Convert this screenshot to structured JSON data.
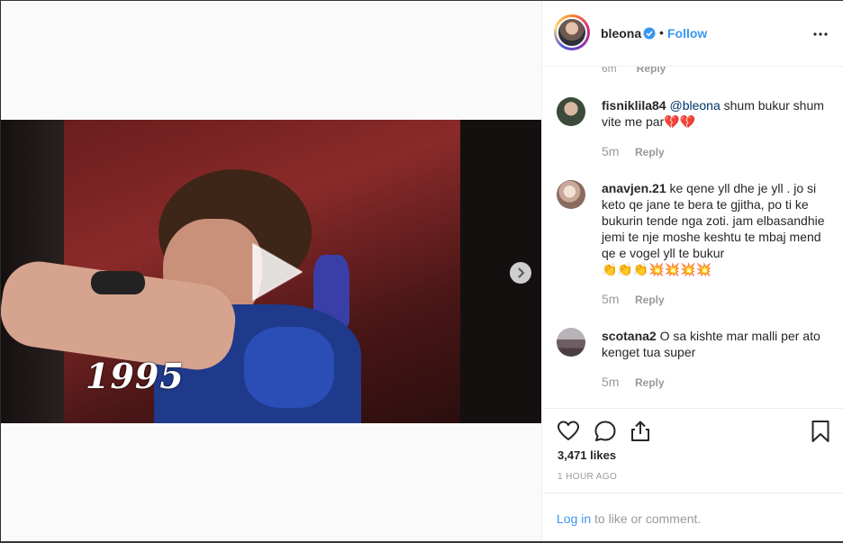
{
  "post": {
    "username": "bleona",
    "separator": "•",
    "follow_label": "Follow",
    "year_overlay": "1995"
  },
  "comments": {
    "partial_time": "6m",
    "partial_reply": "Reply",
    "items": [
      {
        "username": "fisniklila84",
        "mention": "@bleona",
        "text": " shum bukur shum vite me par",
        "emoji": "💔💔",
        "time": "5m",
        "reply": "Reply"
      },
      {
        "username": "anavjen.21",
        "mention": "",
        "text": " ke qene yll dhe je yll . jo si keto qe jane te bera te gjitha, po ti ke bukurin tende nga zoti. jam elbasandhie jemi te nje moshe keshtu te mbaj mend qe e vogel yll te bukur",
        "emoji": "👏👏👏💥💥💥💥",
        "time": "5m",
        "reply": "Reply"
      },
      {
        "username": "scotana2",
        "mention": "",
        "text": " O sa kishte mar malli per ato kenget tua super",
        "emoji": "",
        "time": "5m",
        "reply": "Reply"
      }
    ]
  },
  "stats": {
    "likes": "3,471 likes",
    "timestamp": "1 HOUR AGO"
  },
  "login": {
    "link": "Log in",
    "rest": " to like or comment."
  },
  "icons": {
    "like": "heart-icon",
    "comment": "comment-icon",
    "share": "share-icon",
    "save": "bookmark-icon",
    "verified": "verified-badge-icon",
    "play": "play-icon",
    "next": "chevron-right-icon",
    "more": "more-options-icon"
  },
  "colors": {
    "accent": "#3897f0",
    "text": "#262626",
    "muted": "#999999",
    "mention": "#003569"
  }
}
